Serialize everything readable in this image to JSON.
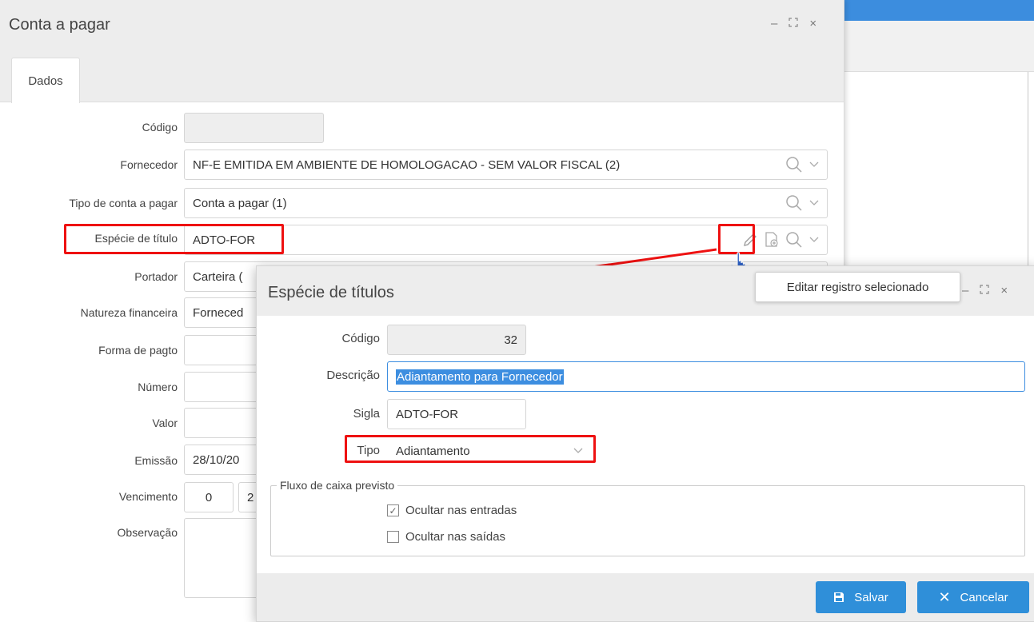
{
  "main": {
    "title": "Conta a pagar",
    "controls": {
      "minimize": "–",
      "maximize": "⛶",
      "close": "×"
    },
    "tab": "Dados",
    "fields": {
      "codigo": {
        "label": "Código",
        "value": ""
      },
      "fornecedor": {
        "label": "Fornecedor",
        "value": "NF-E EMITIDA EM AMBIENTE DE HOMOLOGACAO - SEM VALOR FISCAL (2)"
      },
      "tipo_conta": {
        "label": "Tipo de conta a pagar",
        "value": "Conta a pagar  (1)"
      },
      "especie": {
        "label": "Espécie de título",
        "value": "ADTO-FOR"
      },
      "portador": {
        "label": "Portador",
        "value": "Carteira ("
      },
      "natureza": {
        "label": "Natureza financeira",
        "value": "Forneced"
      },
      "forma_pagto": {
        "label": "Forma de pagto",
        "value": ""
      },
      "numero": {
        "label": "Número",
        "value": ""
      },
      "valor": {
        "label": "Valor",
        "value": ""
      },
      "emissao": {
        "label": "Emissão",
        "value": "28/10/20"
      },
      "vencimento": {
        "label": "Vencimento",
        "value_days": "0",
        "value_date": "2"
      },
      "observacao": {
        "label": "Observação",
        "value": ""
      }
    }
  },
  "tooltip": "Editar registro selecionado",
  "dialog": {
    "title": "Espécie de títulos",
    "controls": {
      "minimize": "–",
      "maximize": "⛶",
      "close": "×"
    },
    "fields": {
      "codigo": {
        "label": "Código",
        "value": "32"
      },
      "descricao": {
        "label": "Descrição",
        "value": "Adiantamento para Fornecedor"
      },
      "sigla": {
        "label": "Sigla",
        "value": "ADTO-FOR"
      },
      "tipo": {
        "label": "Tipo",
        "value": "Adiantamento"
      }
    },
    "fieldset": {
      "legend": "Fluxo de caixa previsto",
      "ocultar_entradas": {
        "label": "Ocultar nas entradas",
        "checked": true
      },
      "ocultar_saidas": {
        "label": "Ocultar nas saídas",
        "checked": false
      }
    },
    "buttons": {
      "save": "Salvar",
      "cancel": "Cancelar"
    }
  },
  "colors": {
    "highlight": "#ee1111",
    "accent": "#2f8fd9",
    "selection": "#3d8ee0"
  }
}
